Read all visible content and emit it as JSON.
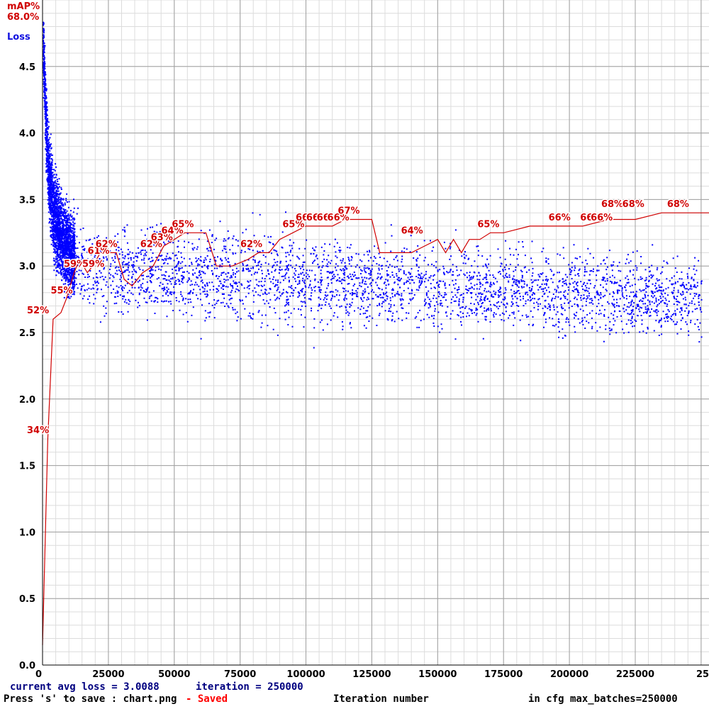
{
  "chart_data": {
    "type": "scatter",
    "y_axis_title": "Loss",
    "map_axis_title": "mAP%",
    "map_current_label": "68.0%",
    "xlim": [
      0,
      253000
    ],
    "ylim": [
      0,
      5.0
    ],
    "x_ticks": [
      0,
      25000,
      50000,
      75000,
      100000,
      125000,
      150000,
      175000,
      200000,
      225000
    ],
    "x_tick_labels": [
      "0",
      "25000",
      "50000",
      "75000",
      "100000",
      "125000",
      "150000",
      "175000",
      "200000",
      "225000",
      "25"
    ],
    "y_ticks": [
      0.0,
      0.5,
      1.0,
      1.5,
      2.0,
      2.5,
      3.0,
      3.5,
      4.0,
      4.5
    ],
    "y_tick_labels": [
      "0.0",
      "0.5",
      "1.0",
      "1.5",
      "2.0",
      "2.5",
      "3.0",
      "3.5",
      "4.0",
      "4.5"
    ],
    "grid": true,
    "loss_trend": {
      "x": [
        0,
        1000,
        2000,
        4000,
        7000,
        10000,
        15000,
        20000,
        30000,
        40000,
        60000,
        80000,
        100000,
        125000,
        150000,
        175000,
        200000,
        225000,
        250000
      ],
      "y": [
        4.7,
        4.1,
        3.7,
        3.4,
        3.2,
        3.1,
        3.0,
        2.98,
        2.97,
        2.95,
        2.93,
        2.9,
        2.88,
        2.86,
        2.84,
        2.82,
        2.8,
        2.78,
        2.75
      ],
      "spread": [
        0.25,
        0.35,
        0.35,
        0.35,
        0.35,
        0.35,
        0.33,
        0.33,
        0.33,
        0.33,
        0.32,
        0.32,
        0.32,
        0.31,
        0.3,
        0.3,
        0.3,
        0.29,
        0.28
      ]
    },
    "map_series": {
      "x": [
        0,
        2000,
        4000,
        7000,
        9000,
        12000,
        14000,
        17000,
        19000,
        22000,
        25000,
        28000,
        31000,
        34000,
        38000,
        42000,
        46000,
        50000,
        54000,
        58000,
        62000,
        66000,
        72000,
        78000,
        82000,
        86000,
        90000,
        95000,
        100000,
        105000,
        110000,
        115000,
        120000,
        125000,
        128000,
        132000,
        136000,
        140000,
        145000,
        150000,
        153000,
        156000,
        159000,
        162000,
        166000,
        170000,
        175000,
        185000,
        195000,
        205000,
        215000,
        225000,
        235000,
        245000,
        253000
      ],
      "y": [
        0.03,
        0.34,
        0.52,
        0.53,
        0.55,
        0.59,
        0.61,
        0.59,
        0.6,
        0.62,
        0.62,
        0.62,
        0.58,
        0.57,
        0.59,
        0.6,
        0.63,
        0.64,
        0.65,
        0.65,
        0.65,
        0.6,
        0.6,
        0.61,
        0.62,
        0.62,
        0.64,
        0.65,
        0.66,
        0.66,
        0.66,
        0.67,
        0.67,
        0.67,
        0.62,
        0.62,
        0.62,
        0.62,
        0.63,
        0.64,
        0.62,
        0.64,
        0.62,
        0.64,
        0.64,
        0.65,
        0.65,
        0.66,
        0.66,
        0.66,
        0.67,
        0.67,
        0.68,
        0.68,
        0.68
      ],
      "labels": [
        {
          "x": 0,
          "y": 0.34,
          "text": "34%"
        },
        {
          "x": 0,
          "y": 0.52,
          "text": "52%"
        },
        {
          "x": 9000,
          "y": 0.55,
          "text": "55%"
        },
        {
          "x": 14000,
          "y": 0.59,
          "text": "59%"
        },
        {
          "x": 21000,
          "y": 0.59,
          "text": "59%"
        },
        {
          "x": 23000,
          "y": 0.61,
          "text": "61%"
        },
        {
          "x": 26000,
          "y": 0.62,
          "text": "62%"
        },
        {
          "x": 43000,
          "y": 0.62,
          "text": "62%"
        },
        {
          "x": 47000,
          "y": 0.63,
          "text": "63%"
        },
        {
          "x": 51000,
          "y": 0.64,
          "text": "64%"
        },
        {
          "x": 55000,
          "y": 0.65,
          "text": "65%"
        },
        {
          "x": 81000,
          "y": 0.62,
          "text": "62%"
        },
        {
          "x": 97000,
          "y": 0.65,
          "text": "65%"
        },
        {
          "x": 102000,
          "y": 0.66,
          "text": "66%"
        },
        {
          "x": 106000,
          "y": 0.66,
          "text": "66%"
        },
        {
          "x": 110000,
          "y": 0.66,
          "text": "66%"
        },
        {
          "x": 114000,
          "y": 0.66,
          "text": "66%"
        },
        {
          "x": 118000,
          "y": 0.67,
          "text": "67%"
        },
        {
          "x": 142000,
          "y": 0.64,
          "text": "64%"
        },
        {
          "x": 171000,
          "y": 0.65,
          "text": "65%"
        },
        {
          "x": 198000,
          "y": 0.66,
          "text": "66%"
        },
        {
          "x": 210000,
          "y": 0.66,
          "text": "66%"
        },
        {
          "x": 214000,
          "y": 0.66,
          "text": "66%"
        },
        {
          "x": 218000,
          "y": 0.68,
          "text": "68%"
        },
        {
          "x": 226000,
          "y": 0.68,
          "text": "68%"
        },
        {
          "x": 243000,
          "y": 0.68,
          "text": "68%"
        }
      ]
    },
    "colors": {
      "loss": "#0000ff",
      "map": "#d00000",
      "grid_major": "#a0a0a0",
      "grid_minor": "#dcdcdc",
      "status_blue": "#000080",
      "saved_red": "#ff0000"
    }
  },
  "status": {
    "avg_loss": "current avg loss = 3.0088",
    "iteration": "iteration = 250000",
    "save_hint": "Press 's' to save : chart.png",
    "saved": "- Saved",
    "x_axis_title": "Iteration number",
    "max_batches": "in cfg max_batches=250000"
  }
}
